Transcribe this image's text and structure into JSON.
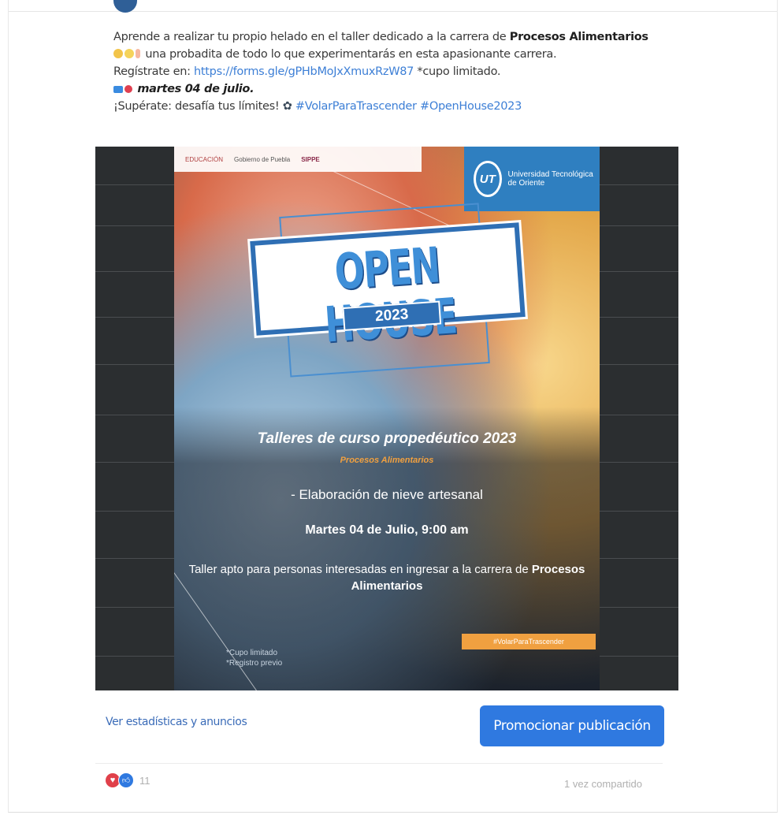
{
  "post": {
    "line1_text": "Aprende a realizar tu propio helado en el taller dedicado a la carrera de ",
    "line1_bold": "Procesos Alimentarios",
    "line2_text": "una probadita de todo lo que experimentarás en esta apasionante carrera.",
    "line3_text": "Regístrate en: ",
    "line3_link": "https://forms.gle/gPHbMoJxXmuxRzW87",
    "line3_after": " *cupo limitado.",
    "line4_date": "martes 04 de julio.",
    "line5_text": "¡Supérate: desafía tus límites! ",
    "line5_hashtags": "#VolarParaTrascender #OpenHouse2023"
  },
  "poster": {
    "logos": [
      "EDUCACIÓN",
      "Gobierno de Puebla",
      "SIPPE"
    ],
    "university": "Universidad Tecnológica de Oriente",
    "university_initials": "UT",
    "open_house": "OPEN HOUSE",
    "year": "2023",
    "title": "Talleres de curso propedéutico 2023",
    "subtitle": "Procesos Alimentarios",
    "activity": "- Elaboración de nieve artesanal",
    "datetime": "Martes 04 de Julio, 9:00 am",
    "note_prefix": "Taller apto para personas interesadas en ingresar a la carrera de ",
    "note_bold": "Procesos Alimentarios",
    "hashtag": "#VolarParaTrascender",
    "fine_print_1": "*Cupo limitado",
    "fine_print_2": "*Registro previo"
  },
  "actions": {
    "stats_link": "Ver estadísticas y anuncios",
    "promote_button": "Promocionar publicación"
  },
  "footer": {
    "reaction_count": "11",
    "shares": "1 vez compartido"
  },
  "colors": {
    "link": "#3d7fd6",
    "button": "#2f79e0",
    "heart": "#e0404a"
  }
}
